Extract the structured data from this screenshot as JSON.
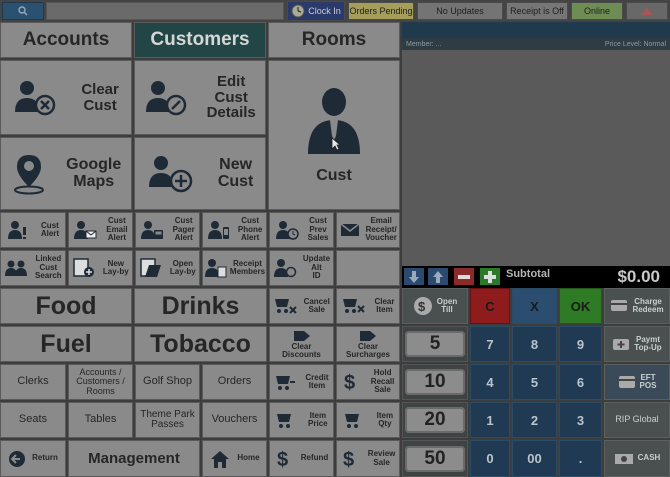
{
  "topbar": {
    "search_icon": "search-icon",
    "clock_in": "Clock In",
    "orders_pending": "Orders Pending",
    "no_updates": "No Updates",
    "receipt_off": "Receipt is Off",
    "online": "Online"
  },
  "tabs": {
    "accounts": "Accounts",
    "customers": "Customers",
    "rooms": "Rooms"
  },
  "customer_actions": {
    "clear_cust": "Clear\nCust",
    "edit_cust": "Edit\nCust\nDetails",
    "cust_big": "Cust",
    "google_maps": "Google\nMaps",
    "new_cust": "New\nCust"
  },
  "small_buttons": {
    "cust_alert": "Cust\nAlert",
    "cust_email_alert": "Cust\nEmail\nAlert",
    "cust_pager_alert": "Cust\nPager\nAlert",
    "cust_phone_alert": "Cust\nPhone\nAlert",
    "cust_prev_sales": "Cust\nPrev\nSales",
    "email_receipt": "Email\nReceipt/\nVoucher",
    "linked_cust_search": "Linked\nCust\nSearch",
    "new_layby": "New\nLay-by",
    "open_layby": "Open\nLay-by",
    "receipt_members": "Receipt\nMembers",
    "update_alt_id": "Update\nAlt\nID"
  },
  "categories": {
    "food": "Food",
    "drinks": "Drinks",
    "fuel": "Fuel",
    "tobacco": "Tobacco"
  },
  "grid_buttons": {
    "clerks": "Clerks",
    "acct_cust_rooms": "Accounts /\nCustomers /\nRooms",
    "golf_shop": "Golf Shop",
    "orders": "Orders",
    "seats": "Seats",
    "tables": "Tables",
    "theme_park": "Theme Park\nPasses",
    "vouchers": "Vouchers",
    "return": "Return",
    "management": "Management",
    "home": "Home"
  },
  "sale_actions": {
    "cancel_sale": "Cancel\nSale",
    "clear_item": "Clear\nItem",
    "clear_discounts": "Clear\nDiscounts",
    "clear_surcharges": "Clear\nSurcharges",
    "credit_item": "Credit\nItem",
    "hold_recall": "Hold\nRecall\nSale",
    "item_price": "Item\nPrice",
    "item_qty": "Item\nQty",
    "refund": "Refund",
    "review_sale": "Review\nSale"
  },
  "sale_panel": {
    "member_label": "Member: ...",
    "price_level": "Price Level: Normal",
    "subtotal_label": "Subtotal",
    "subtotal_value": "$0.00"
  },
  "keypad": {
    "open_till": "Open\nTill",
    "clear": "C",
    "cancel": "X",
    "ok": "OK",
    "charge_redeem": "Charge\nRedeem",
    "paymt_topup": "Paymt\nTop-Up",
    "eft_pos": "EFT\nPOS",
    "rip_global": "RIP Global",
    "cash": "CASH",
    "tenders": [
      "5",
      "10",
      "20",
      "50"
    ],
    "digits": [
      "7",
      "8",
      "9",
      "4",
      "5",
      "6",
      "1",
      "2",
      "3",
      "0",
      "00",
      "."
    ]
  },
  "colors": {
    "selected_tab": "#224646",
    "key_blue": "#1f3a52",
    "key_red": "#8e1c1c",
    "key_green": "#2f7a24",
    "subtotal_bar": "#000000"
  }
}
